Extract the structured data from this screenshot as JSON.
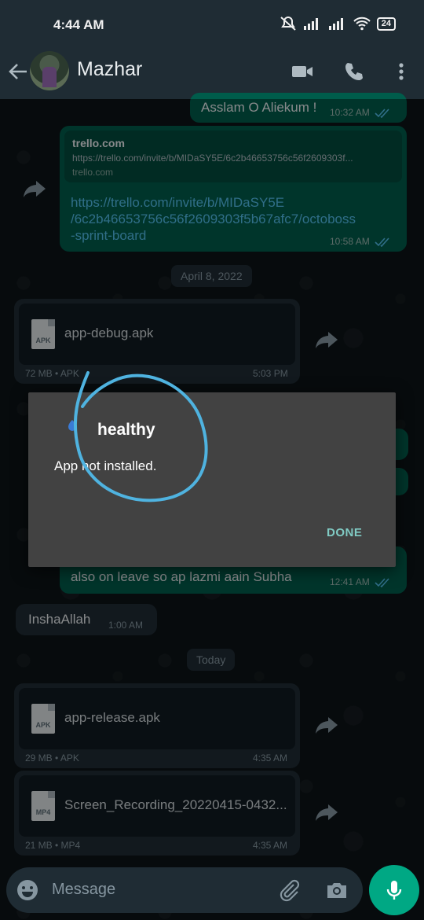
{
  "status": {
    "time": "4:44 AM",
    "battery": "24"
  },
  "header": {
    "contact_name": "Mazhar"
  },
  "messages": {
    "greeting": {
      "text": "Asslam O Aliekum !",
      "time": "10:32 AM"
    },
    "link_preview": {
      "title": "trello.com",
      "url": "https://trello.com/invite/b/MIDaSY5E/6c2b46653756c56f2609303f...",
      "domain": "trello.com"
    },
    "link_msg": {
      "line1": "https://trello.com/invite/b/MIDaSY5E",
      "line2": "/6c2b46653756c56f2609303f5b67afc7/octoboss",
      "line3": "-sprint-board",
      "time": "10:58 AM"
    },
    "date1": "April 8, 2022",
    "file1": {
      "name": "app-debug.apk",
      "ext": "APK",
      "meta": "72 MB • APK",
      "time": "5:03 PM"
    },
    "leave_msg": {
      "text": "also on leave so ap lazmi aain Subha",
      "time": "12:41 AM"
    },
    "inshaallah": {
      "text": "InshaAllah",
      "time": "1:00 AM"
    },
    "date2": "Today",
    "file2": {
      "name": "app-release.apk",
      "ext": "APK",
      "meta": "29 MB • APK",
      "time": "4:35 AM"
    },
    "file3": {
      "name": "Screen_Recording_20220415-0432...",
      "ext": "MP4",
      "meta": "21 MB • MP4",
      "time": "4:35 AM"
    }
  },
  "dialog": {
    "title": "healthy",
    "message": "App not installed.",
    "done_label": "DONE"
  },
  "input": {
    "placeholder": "Message"
  },
  "colors": {
    "header": "#1f2c34",
    "outgoing": "#005c4b",
    "incoming": "#1f2c34",
    "accent": "#00a884",
    "dialog": "#424242",
    "done": "#80cbc4",
    "annotation": "#4fb3e0"
  }
}
